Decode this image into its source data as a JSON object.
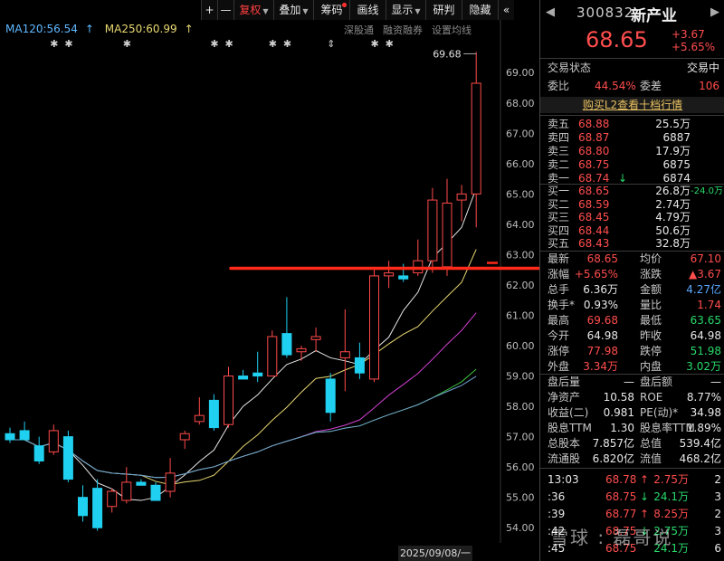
{
  "toolbar": {
    "buttons": [
      {
        "label": "+",
        "w": 18
      },
      {
        "label": "—",
        "w": 18
      },
      {
        "label": "复权",
        "w": 44,
        "caret": true,
        "red": true
      },
      {
        "label": "叠加",
        "w": 44,
        "caret": true
      },
      {
        "label": "筹码",
        "w": 40,
        "dot": true
      },
      {
        "label": "画线",
        "w": 40
      },
      {
        "label": "显示",
        "w": 44,
        "caret": true
      },
      {
        "label": "研判",
        "w": 40
      },
      {
        "label": "隐藏",
        "w": 40
      },
      {
        "label": "«",
        "w": 18
      }
    ]
  },
  "indicators": {
    "ma120": "MA120:56.54",
    "ma250": "MA250:60.99",
    "ma120_color": "#5fb8ff",
    "ma250_color": "#e8d870",
    "tools": [
      "深股通",
      "融资融券",
      "设置均线"
    ]
  },
  "chart_data": {
    "type": "candlestick",
    "ylim": [
      53.5,
      70.2
    ],
    "yticks": [
      54.0,
      55.0,
      56.0,
      57.0,
      58.0,
      59.0,
      60.0,
      61.0,
      62.0,
      63.0,
      64.0,
      65.0,
      66.0,
      67.0,
      68.0,
      69.0
    ],
    "high_label": "69.68",
    "resistance_level": 62.55,
    "cursor_date": "2025/09/08/一",
    "up_color": "#ff4a4a",
    "down_color": "#20d0f0",
    "candles": [
      {
        "o": 57.1,
        "h": 57.3,
        "l": 56.8,
        "c": 56.9
      },
      {
        "o": 57.2,
        "h": 57.5,
        "l": 56.9,
        "c": 56.9
      },
      {
        "o": 56.7,
        "h": 57.0,
        "l": 56.1,
        "c": 56.2
      },
      {
        "o": 56.5,
        "h": 57.4,
        "l": 56.4,
        "c": 57.2
      },
      {
        "o": 57.0,
        "h": 57.2,
        "l": 55.5,
        "c": 55.6
      },
      {
        "o": 55.0,
        "h": 55.4,
        "l": 54.2,
        "c": 54.4
      },
      {
        "o": 55.3,
        "h": 55.6,
        "l": 53.9,
        "c": 54.0
      },
      {
        "o": 54.7,
        "h": 55.3,
        "l": 54.5,
        "c": 55.2
      },
      {
        "o": 54.9,
        "h": 56.0,
        "l": 54.8,
        "c": 55.5
      },
      {
        "o": 55.5,
        "h": 55.6,
        "l": 55.4,
        "c": 55.4
      },
      {
        "o": 55.4,
        "h": 55.5,
        "l": 54.9,
        "c": 54.9
      },
      {
        "o": 55.2,
        "h": 56.3,
        "l": 55.0,
        "c": 55.8
      },
      {
        "o": 56.9,
        "h": 57.2,
        "l": 56.6,
        "c": 57.1
      },
      {
        "o": 57.5,
        "h": 58.3,
        "l": 57.4,
        "c": 57.7
      },
      {
        "o": 58.2,
        "h": 58.4,
        "l": 57.2,
        "c": 57.3
      },
      {
        "o": 57.4,
        "h": 59.3,
        "l": 57.3,
        "c": 59.0
      },
      {
        "o": 59.0,
        "h": 59.2,
        "l": 58.9,
        "c": 58.9
      },
      {
        "o": 59.1,
        "h": 59.8,
        "l": 58.8,
        "c": 59.0
      },
      {
        "o": 59.0,
        "h": 60.5,
        "l": 59.0,
        "c": 60.3
      },
      {
        "o": 60.4,
        "h": 61.6,
        "l": 59.6,
        "c": 59.7
      },
      {
        "o": 59.8,
        "h": 60.0,
        "l": 59.5,
        "c": 59.9
      },
      {
        "o": 60.2,
        "h": 60.6,
        "l": 59.8,
        "c": 60.3
      },
      {
        "o": 58.9,
        "h": 59.1,
        "l": 57.5,
        "c": 57.8
      },
      {
        "o": 59.6,
        "h": 61.2,
        "l": 58.5,
        "c": 59.8
      },
      {
        "o": 59.6,
        "h": 60.1,
        "l": 58.9,
        "c": 59.1
      },
      {
        "o": 58.9,
        "h": 62.6,
        "l": 58.8,
        "c": 62.3
      },
      {
        "o": 62.3,
        "h": 62.8,
        "l": 61.9,
        "c": 62.4
      },
      {
        "o": 62.3,
        "h": 62.7,
        "l": 62.1,
        "c": 62.2
      },
      {
        "o": 62.4,
        "h": 63.5,
        "l": 62.3,
        "c": 62.8
      },
      {
        "o": 62.8,
        "h": 65.2,
        "l": 62.4,
        "c": 64.8
      },
      {
        "o": 62.6,
        "h": 65.5,
        "l": 62.3,
        "c": 64.7
      },
      {
        "o": 64.8,
        "h": 65.3,
        "l": 64.1,
        "c": 65.0
      },
      {
        "o": 65.0,
        "h": 69.68,
        "l": 63.9,
        "c": 68.65
      }
    ]
  },
  "panel": {
    "code": "300832",
    "name": "新产业",
    "price": "68.65",
    "change": "+3.67",
    "change_pct": "+5.65%",
    "status_label": "交易状态",
    "status_value": "交易中",
    "weibi_label": "委比",
    "weibi_value": "44.54%",
    "weicha_label": "委差",
    "weicha_value": "106",
    "l2_text": "购买L2查看十档行情",
    "asks": [
      {
        "label": "卖五",
        "price": "68.88",
        "vol": "25.5万"
      },
      {
        "label": "卖四",
        "price": "68.87",
        "vol": "6887"
      },
      {
        "label": "卖三",
        "price": "68.80",
        "vol": "17.9万"
      },
      {
        "label": "卖二",
        "price": "68.75",
        "vol": "6875"
      },
      {
        "label": "卖一",
        "price": "68.74",
        "vol": "6874",
        "arrow": "↓"
      }
    ],
    "bids": [
      {
        "label": "买一",
        "price": "68.65",
        "vol": "26.8万",
        "extra": "-24.0万"
      },
      {
        "label": "买二",
        "price": "68.59",
        "vol": "2.74万"
      },
      {
        "label": "买三",
        "price": "68.45",
        "vol": "4.79万"
      },
      {
        "label": "买四",
        "price": "68.44",
        "vol": "50.6万"
      },
      {
        "label": "买五",
        "price": "68.43",
        "vol": "32.8万"
      }
    ],
    "stats": [
      {
        "l1": "最新",
        "v1": "68.65",
        "c1": "red",
        "l2": "均价",
        "v2": "67.10",
        "c2": "red"
      },
      {
        "l1": "涨幅",
        "v1": "+5.65%",
        "c1": "red",
        "l2": "涨跌",
        "v2": "▲3.67",
        "c2": "red"
      },
      {
        "l1": "总手",
        "v1": "6.36万",
        "c1": "white",
        "l2": "金额",
        "v2": "4.27亿",
        "c2": "blue"
      },
      {
        "l1": "换手*",
        "v1": "0.93%",
        "c1": "white",
        "l2": "量比",
        "v2": "1.74",
        "c2": "red"
      },
      {
        "l1": "最高",
        "v1": "69.68",
        "c1": "red",
        "l2": "最低",
        "v2": "63.65",
        "c2": "green"
      },
      {
        "l1": "今开",
        "v1": "64.98",
        "c1": "white",
        "l2": "昨收",
        "v2": "64.98",
        "c2": "white"
      },
      {
        "l1": "涨停",
        "v1": "77.98",
        "c1": "red",
        "l2": "跌停",
        "v2": "51.98",
        "c2": "green"
      },
      {
        "l1": "外盘",
        "v1": "3.34万",
        "c1": "red",
        "l2": "内盘",
        "v2": "3.02万",
        "c2": "green"
      }
    ],
    "stats2": [
      {
        "l1": "盘后量",
        "v1": "—",
        "c1": "white",
        "l2": "盘后额",
        "v2": "—",
        "c2": "white"
      },
      {
        "l1": "净资产",
        "v1": "10.58",
        "c1": "white",
        "l2": "ROE",
        "v2": "8.77%",
        "c2": "white"
      },
      {
        "l1": "收益(二)",
        "v1": "0.981",
        "c1": "white",
        "l2": "PE(动)*",
        "v2": "34.98",
        "c2": "white"
      },
      {
        "l1": "股息TTM",
        "v1": "1.30",
        "c1": "white",
        "l2": "股息率TTM",
        "v2": "1.89%",
        "c2": "white"
      },
      {
        "l1": "总股本",
        "v1": "7.857亿",
        "c1": "white",
        "l2": "总值",
        "v2": "539.4亿",
        "c2": "white"
      },
      {
        "l1": "流通股",
        "v1": "6.820亿",
        "c1": "white",
        "l2": "流值",
        "v2": "468.2亿",
        "c2": "white"
      }
    ],
    "ticks": [
      {
        "time": "13:03",
        "price": "68.78",
        "arrow": "↑",
        "ac": "red",
        "vol": "2.75万",
        "vc": "red",
        "n": "2"
      },
      {
        "time": ":36",
        "price": "68.75",
        "arrow": "↓",
        "ac": "green",
        "vol": "24.1万",
        "vc": "green",
        "n": "3"
      },
      {
        "time": ":39",
        "price": "68.77",
        "arrow": "↑",
        "ac": "red",
        "vol": "8.25万",
        "vc": "red",
        "n": "2"
      },
      {
        "time": ":42",
        "price": "68.75",
        "arrow": "↓",
        "ac": "green",
        "vol": "2.75万",
        "vc": "green",
        "n": "3"
      },
      {
        "time": ":45",
        "price": "68.75",
        "arrow": "",
        "ac": "red",
        "vol": "24.1万",
        "vc": "green",
        "n": "6"
      }
    ]
  },
  "watermark": "雪球 : 磊哥说"
}
